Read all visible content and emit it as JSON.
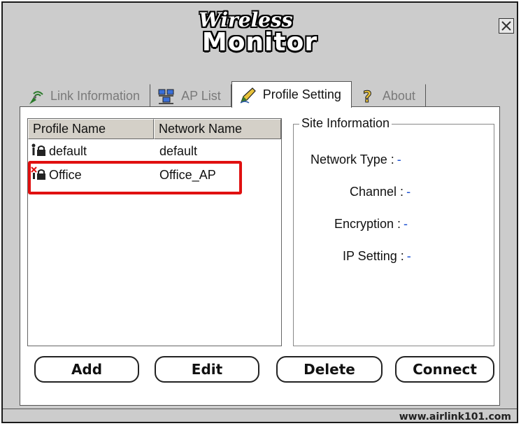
{
  "logo": {
    "line1": "Wireless",
    "line2": "Monitor"
  },
  "tabs": [
    {
      "label": "Link Information",
      "icon": "antenna-icon",
      "active": false
    },
    {
      "label": "AP List",
      "icon": "network-computers-icon",
      "active": false
    },
    {
      "label": "Profile Setting",
      "icon": "pencil-icon",
      "active": true
    },
    {
      "label": "About",
      "icon": "question-mark-icon",
      "active": false
    }
  ],
  "profile_list": {
    "columns": [
      "Profile Name",
      "Network Name"
    ],
    "rows": [
      {
        "profile": "default",
        "network": "default",
        "icon": "person-lock-icon"
      },
      {
        "profile": "Office",
        "network": "Office_AP",
        "icon": "disconnected-lock-icon",
        "highlighted": true
      }
    ]
  },
  "site_info": {
    "title": "Site Information",
    "network_type_label": "Network Type :",
    "network_type_value": "-",
    "channel_label": "Channel :",
    "channel_value": "-",
    "encryption_label": "Encryption :",
    "encryption_value": "-",
    "ip_setting_label": "IP Setting :",
    "ip_setting_value": "-"
  },
  "buttons": {
    "add": "Add",
    "edit": "Edit",
    "delete": "Delete",
    "connect": "Connect"
  },
  "footer": {
    "url": "www.airlink101.com"
  },
  "colors": {
    "window_bg": "#cccccc",
    "highlight": "#e01010",
    "value": "#1a4fd0"
  }
}
